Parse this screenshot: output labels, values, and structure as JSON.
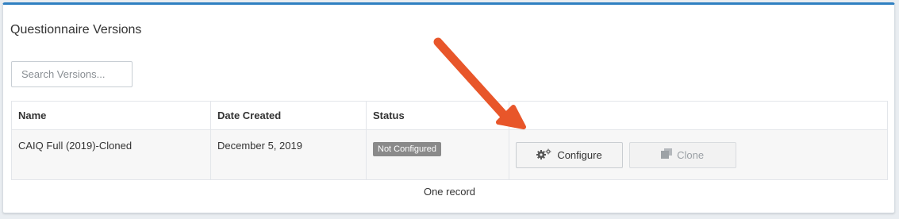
{
  "panel": {
    "title": "Questionnaire Versions"
  },
  "search": {
    "placeholder": "Search Versions..."
  },
  "table": {
    "columns": [
      "Name",
      "Date Created",
      "Status",
      ""
    ],
    "rows": [
      {
        "name": "CAIQ Full (2019)-Cloned",
        "date_created": "December 5, 2019",
        "status": "Not Configured",
        "actions": {
          "configure": "Configure",
          "clone": "Clone"
        }
      }
    ]
  },
  "footer": {
    "record_count": "One record"
  },
  "colors": {
    "accent": "#2f7fc1",
    "arrow": "#e8562a",
    "badge": "#8a8a8a"
  },
  "icons": {
    "configure": "gears-icon",
    "clone": "copy-icon",
    "annotation": "arrow-icon"
  }
}
